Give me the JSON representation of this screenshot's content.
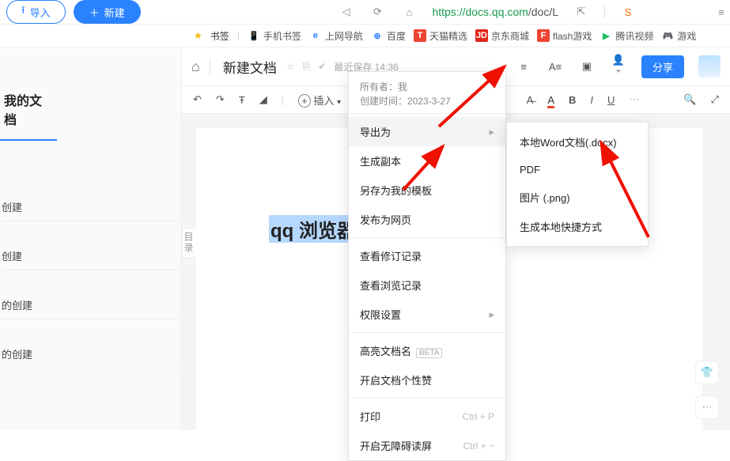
{
  "browser": {
    "url_host": "https://docs.qq.com",
    "url_path": "/doc/L",
    "import_btn": "导入",
    "new_btn": "新建"
  },
  "bookmarks": {
    "bm_label": "书签",
    "items": [
      "手机书签",
      "上网导航",
      "百度",
      "天猫精选",
      "京东商城",
      "flash游戏",
      "腾讯视频",
      "游戏"
    ]
  },
  "sidebar": {
    "title": "我的文档",
    "items": [
      "创建",
      "创建",
      "的创建",
      "的创建"
    ]
  },
  "doc": {
    "title": "新建文档",
    "save_text": "最近保存 14:36",
    "share": "分享",
    "insert": "插入"
  },
  "menu": {
    "owner_label": "所有者：",
    "owner_value": "我",
    "created_label": "创建时间：",
    "created_value": "2023-3-27",
    "export": "导出为",
    "copy": "生成副本",
    "save_tpl": "另存为我的模板",
    "publish": "发布为网页",
    "revisions": "查看修订记录",
    "history": "查看浏览记录",
    "perm": "权限设置",
    "highlight": "高亮文档名",
    "beta": "BETA",
    "like": "开启文档个性赞",
    "print": "打印",
    "print_k": "Ctrl + P",
    "a11y": "开启无障碍读屏",
    "a11y_k": "Ctrl + ~"
  },
  "submenu": {
    "docx": "本地Word文档(.docx)",
    "pdf": "PDF",
    "png": "图片 (.png)",
    "shortcut": "生成本地快捷方式"
  },
  "canvas": {
    "mulu": "目录",
    "selected": "qq 浏览器怎"
  }
}
